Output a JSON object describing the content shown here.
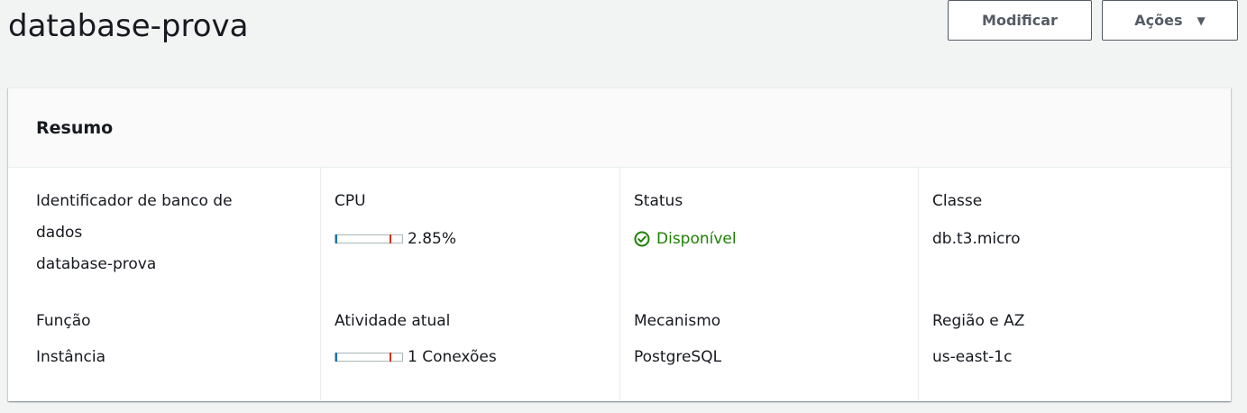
{
  "header": {
    "title": "database-prova",
    "modify_label": "Modificar",
    "actions_label": "Ações"
  },
  "summary": {
    "title": "Resumo",
    "identifier": {
      "label": "Identificador de banco de dados",
      "value": "database-prova"
    },
    "cpu": {
      "label": "CPU",
      "value": "2.85%",
      "percent": 2.85
    },
    "status": {
      "label": "Status",
      "value": "Disponível",
      "icon": "check-circle-icon",
      "color": "#1d8102"
    },
    "class": {
      "label": "Classe",
      "value": "db.t3.micro"
    },
    "role": {
      "label": "Função",
      "value": "Instância"
    },
    "activity": {
      "label": "Atividade atual",
      "value": "1 Conexões"
    },
    "engine": {
      "label": "Mecanismo",
      "value": "PostgreSQL"
    },
    "region": {
      "label": "Região e AZ",
      "value": "us-east-1c"
    }
  }
}
